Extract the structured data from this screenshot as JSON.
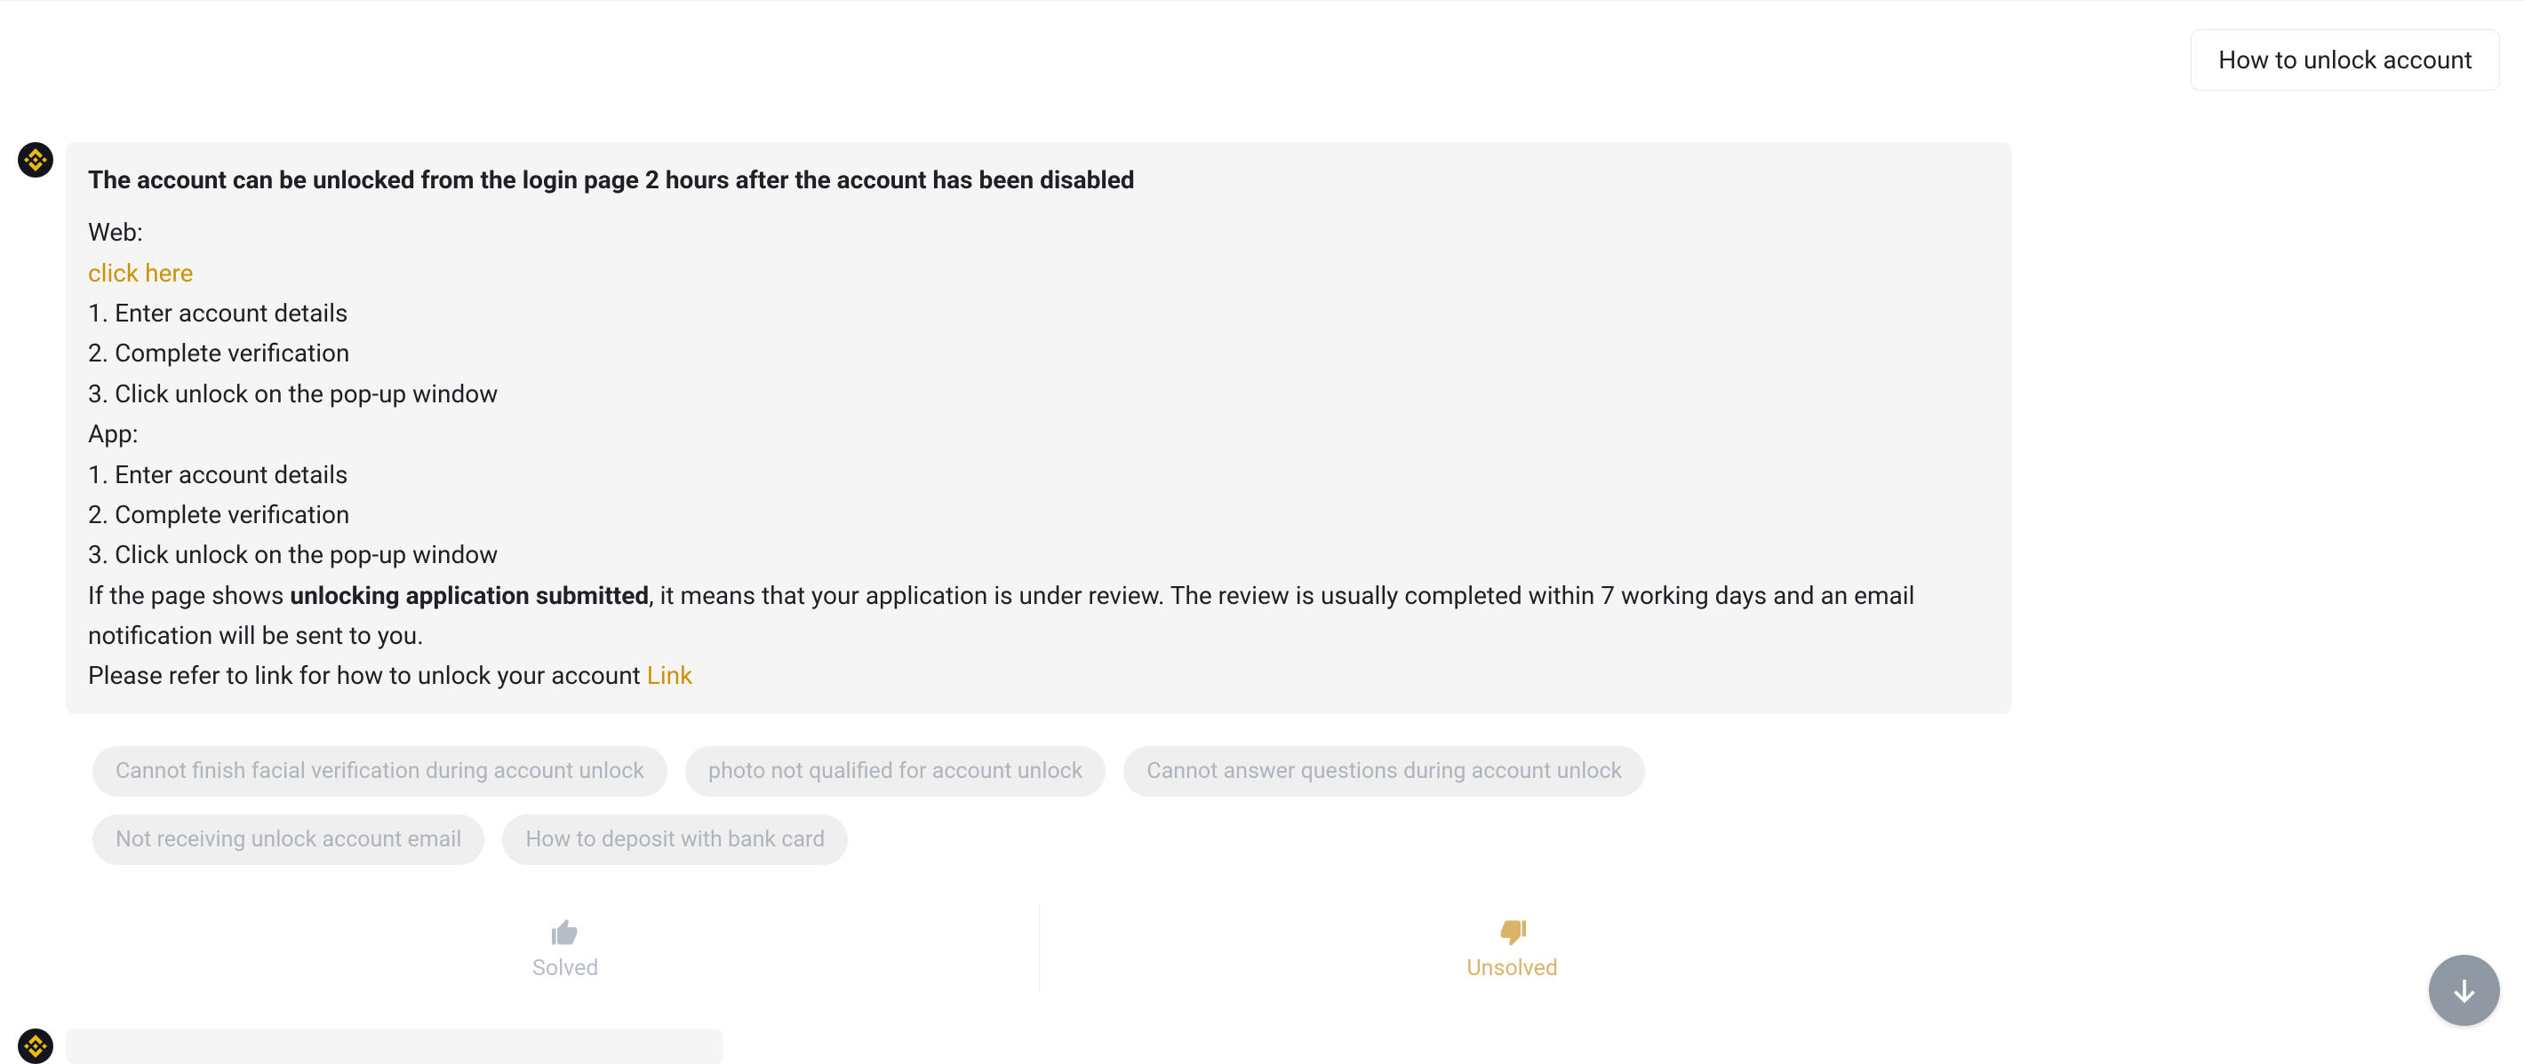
{
  "user_message": "How to unlock account",
  "bot": {
    "title": "The account can be unlocked from the login page 2 hours after the account has been disabled",
    "web_label": "Web:",
    "click_here": "click here",
    "web_steps": [
      "1. Enter account details",
      "2. Complete verification",
      "3. Click unlock on the pop-up window"
    ],
    "app_label": "App:",
    "app_steps": [
      "1. Enter account details",
      "2. Complete verification",
      "3. Click unlock on the pop-up window"
    ],
    "review_prefix": "If the page shows ",
    "review_bold": "unlocking application submitted",
    "review_suffix": ", it means that your application is under review. The review is usually completed within 7 working days and an email notification will be sent to you.",
    "refer_prefix": "Please refer to link for how to unlock your account ",
    "refer_link": "Link"
  },
  "suggestions": [
    "Cannot finish facial verification during account unlock",
    "photo not qualified for account unlock",
    "Cannot answer questions during account unlock",
    "Not receiving unlock account email",
    "How to deposit with bank card"
  ],
  "feedback": {
    "solved": "Solved",
    "unsolved": "Unsolved"
  },
  "colors": {
    "link": "#c99400",
    "chip_text": "#aeb4bc",
    "unsolved": "#d9b36a"
  }
}
